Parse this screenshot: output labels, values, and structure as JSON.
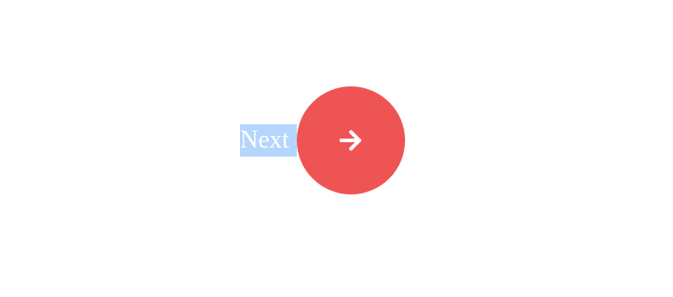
{
  "next": {
    "label": "Next",
    "icon": "arrow-right-icon",
    "label_highlight_color": "#b4d5fe",
    "button_color": "#ef5454",
    "icon_color": "#ffffff"
  }
}
